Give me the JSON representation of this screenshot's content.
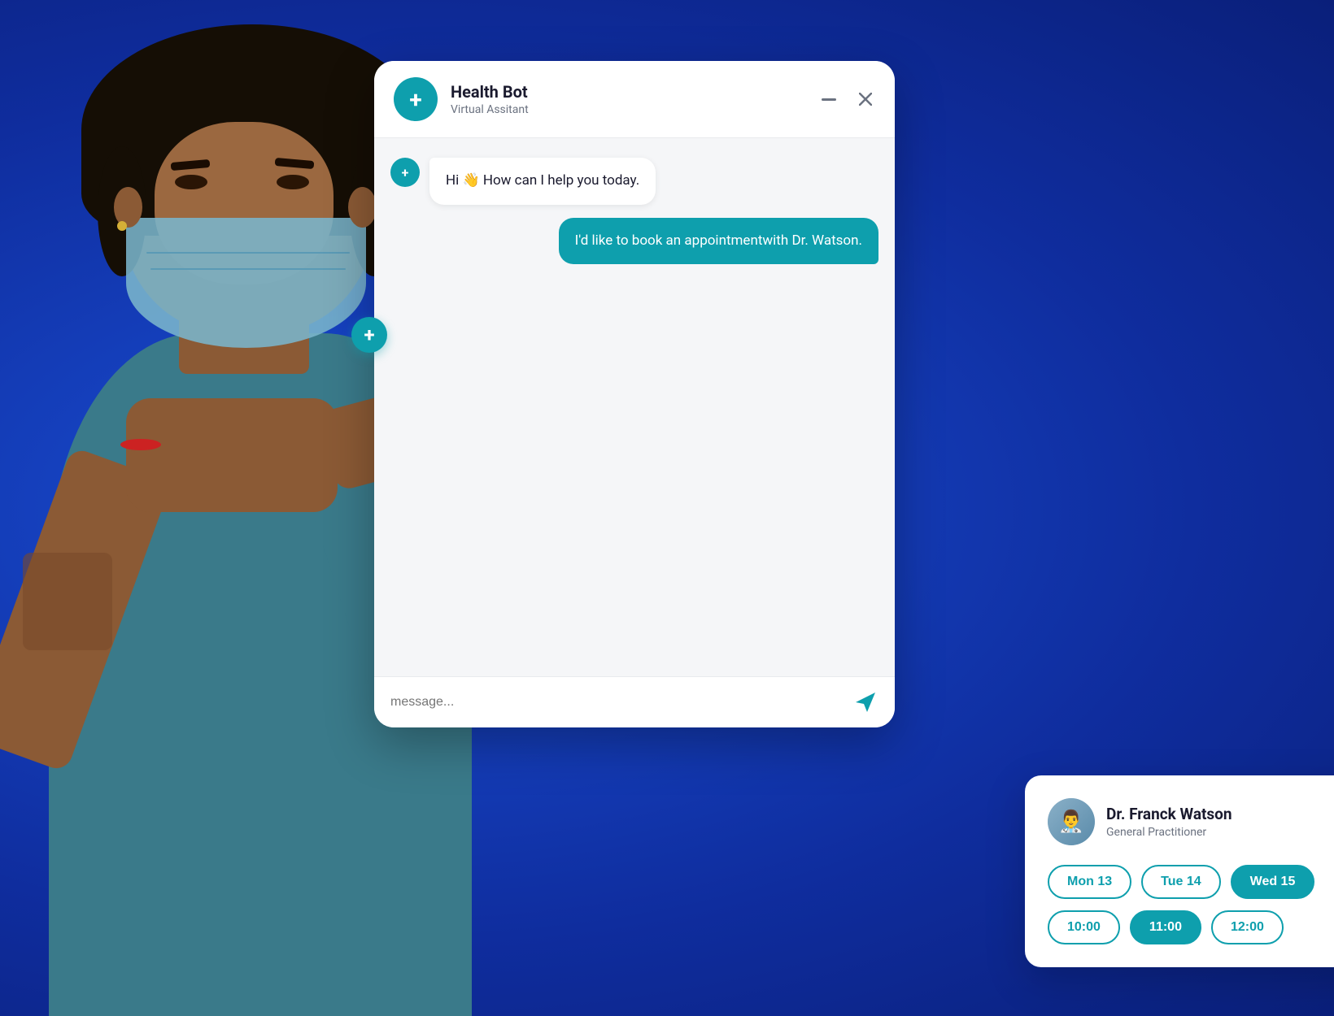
{
  "background": {
    "color": "#1a3bbf"
  },
  "chatWindow": {
    "header": {
      "botName": "Health Bot",
      "botSubtitle": "Virtual Assitant",
      "minimizeLabel": "minimize",
      "closeLabel": "close"
    },
    "messages": [
      {
        "id": "msg1",
        "type": "bot",
        "text": "Hi 👋 How can I help you today."
      },
      {
        "id": "msg2",
        "type": "user",
        "text": "I'd like to book an appointmentwith Dr. Watson."
      }
    ],
    "appointmentCard": {
      "doctorName": "Dr. Franck Watson",
      "doctorSpecialty": "General Practitioner",
      "doctorEmoji": "👨‍⚕️",
      "dateSlots": [
        {
          "label": "Mon 13",
          "active": false
        },
        {
          "label": "Tue 14",
          "active": false
        },
        {
          "label": "Wed 15",
          "active": true
        }
      ],
      "timeSlots": [
        {
          "label": "10:00",
          "active": false
        },
        {
          "label": "11:00",
          "active": true
        },
        {
          "label": "12:00",
          "active": false
        }
      ]
    },
    "footer": {
      "inputPlaceholder": "message...",
      "sendIconLabel": "send"
    }
  },
  "colors": {
    "teal": "#0e9fad",
    "darkBlue": "#1a3bbf",
    "white": "#ffffff",
    "textDark": "#1a1a2e",
    "textGray": "#6b7280"
  }
}
